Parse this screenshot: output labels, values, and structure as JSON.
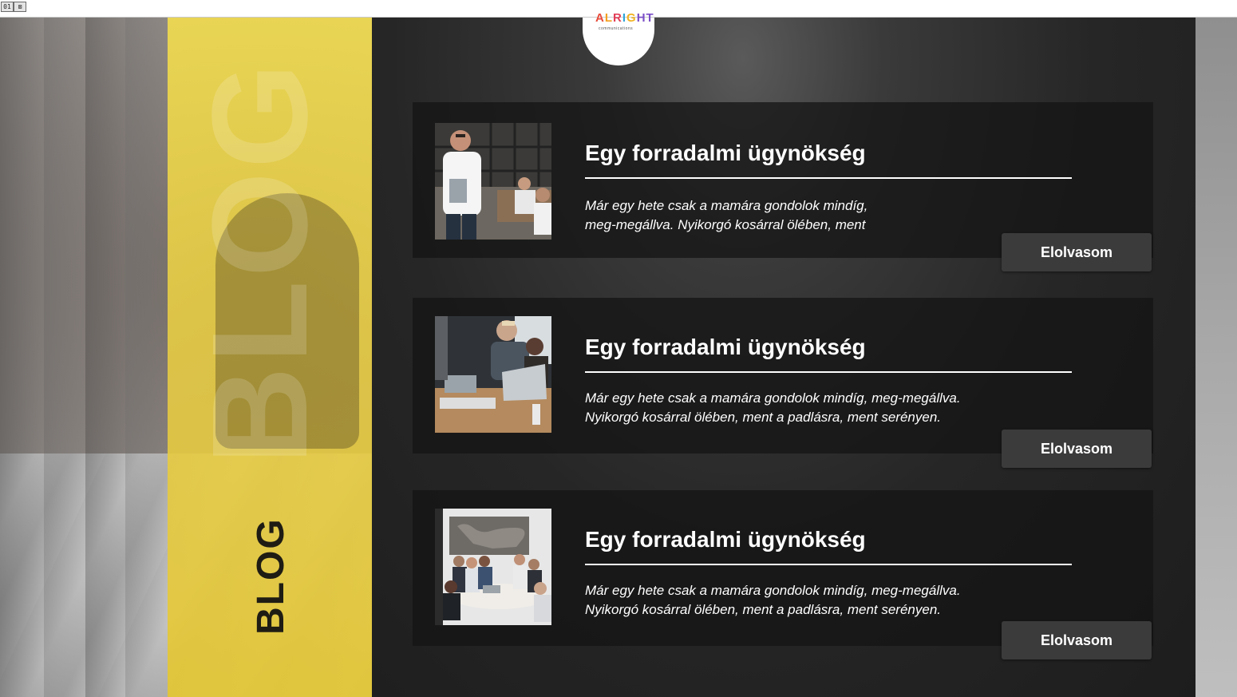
{
  "window": {
    "controls": [
      "01",
      "⊠"
    ]
  },
  "logo": {
    "letters": [
      "A",
      "L",
      "R",
      "I",
      "G",
      "HT"
    ],
    "tagline": "communications"
  },
  "sidebar": {
    "label": "BLOG"
  },
  "posts": [
    {
      "title": "Egy forradalmi ügynökség",
      "excerpt_line1": "Már egy hete csak a mamára gondolok mindíg,",
      "excerpt_line2": "meg-megállva. Nyikorgó kosárral ölében, ment",
      "button": "Elolvasom",
      "image": "portrait-man-with-laptop"
    },
    {
      "title": "Egy forradalmi ügynökség",
      "excerpt_line1": "Már egy hete csak a mamára gondolok mindíg, meg-megállva.",
      "excerpt_line2": "Nyikorgó kosárral ölében, ment a padlásra, ment serényen.",
      "button": "Elolvasom",
      "image": "office-meeting-laptops"
    },
    {
      "title": "Egy forradalmi ügynökség",
      "excerpt_line1": "Már egy hete csak a mamára gondolok mindíg, meg-megállva.",
      "excerpt_line2": "Nyikorgó kosárral ölében, ment a padlásra, ment serényen.",
      "button": "Elolvasom",
      "image": "conference-room-team"
    }
  ],
  "colors": {
    "accent_yellow": "#f2d94f",
    "dark_bg": "#262626",
    "button_bg": "#3b3b3b",
    "text": "#ffffff"
  }
}
